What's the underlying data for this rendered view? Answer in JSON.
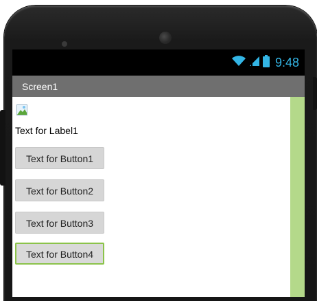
{
  "status": {
    "time": "9:48",
    "time_color": "#33b5e5",
    "icons": [
      "wifi-icon",
      "signal-icon",
      "battery-icon"
    ]
  },
  "screen": {
    "title": "Screen1",
    "titlebar_color": "#6f6f6f",
    "strip_color": "#b4d98a"
  },
  "components": {
    "image_icon": "image-icon",
    "label1": "Text for Label1",
    "buttons": [
      {
        "label": "Text for Button1"
      },
      {
        "label": "Text for Button2"
      },
      {
        "label": "Text for Button3"
      },
      {
        "label": "Text for Button4",
        "selected": true
      }
    ],
    "selected_color": "#8bc34a"
  }
}
